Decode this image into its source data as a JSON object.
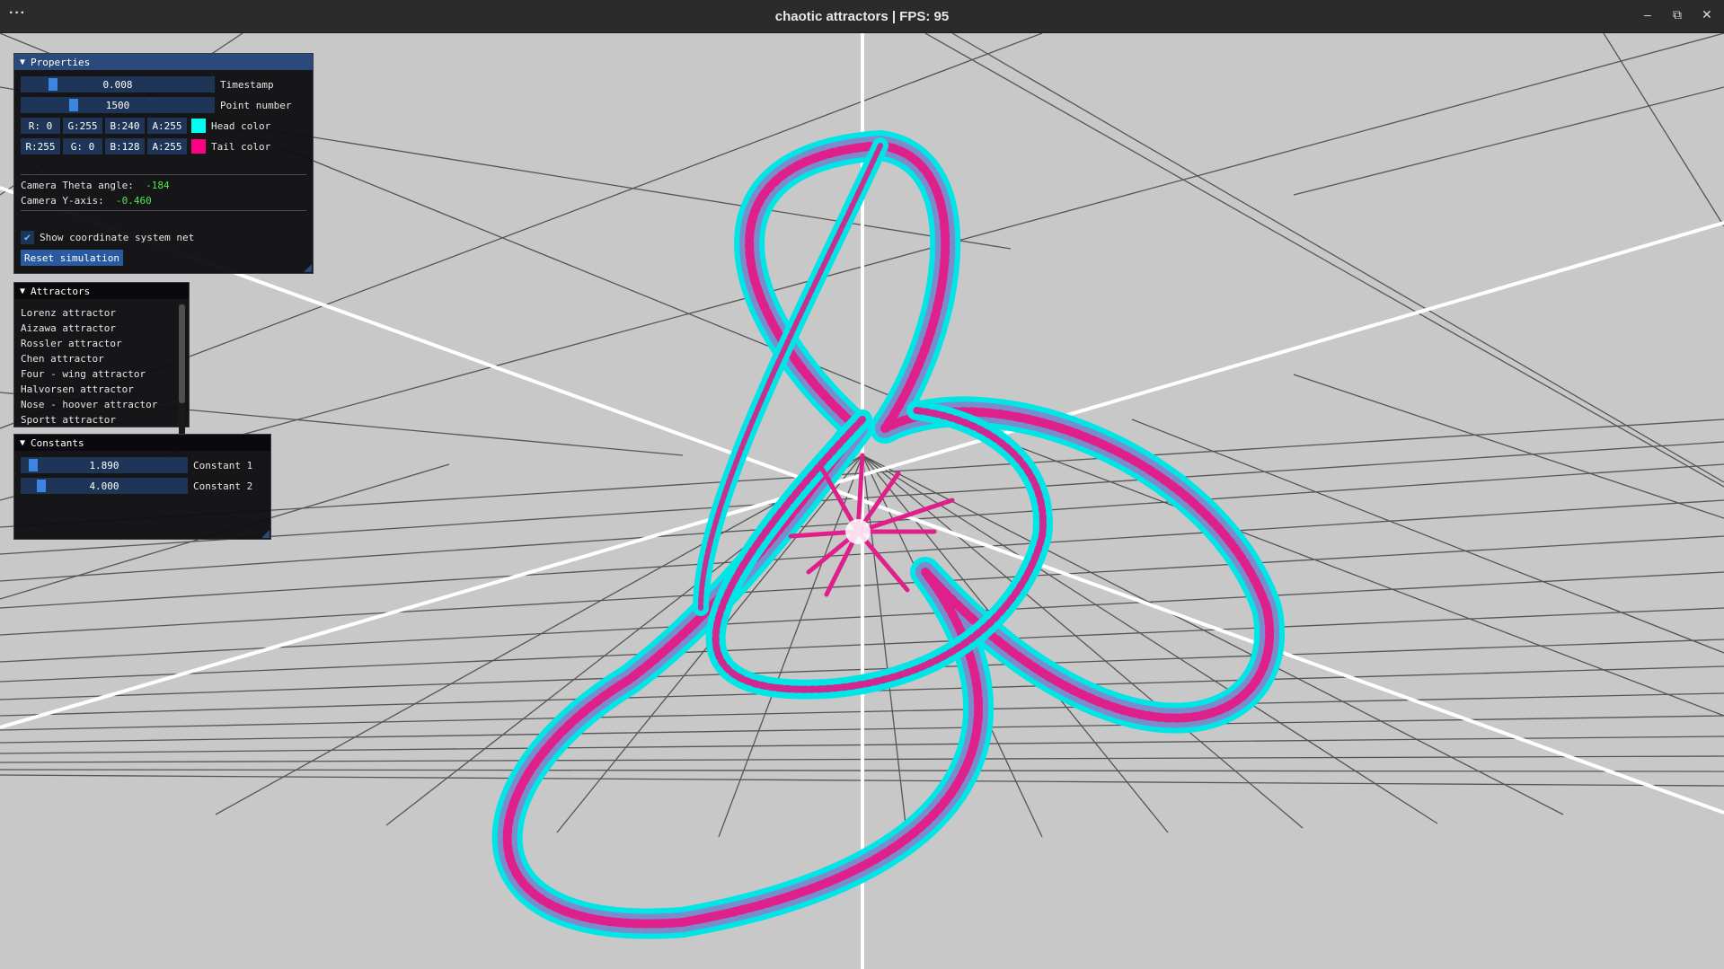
{
  "window": {
    "title": "chaotic attractors | FPS: 95",
    "menu_glyph": "···",
    "minimize_glyph": "–",
    "restore_glyph": "⧉",
    "close_glyph": "✕"
  },
  "colors": {
    "background": "#c8c8c8",
    "head": "#00ffef",
    "tail": "#ff0080",
    "accent": "#294a7a"
  },
  "properties": {
    "header": "Properties",
    "timestamp": {
      "value": "0.008",
      "label": "Timestamp",
      "fraction": 0.15
    },
    "point_number": {
      "value": "1500",
      "label": "Point number",
      "fraction": 0.26
    },
    "head_color": {
      "r": "R:  0",
      "g": "G:255",
      "b": "B:240",
      "a": "A:255",
      "label": "Head color",
      "swatch": "#00ffef"
    },
    "tail_color": {
      "r": "R:255",
      "g": "G:  0",
      "b": "B:128",
      "a": "A:255",
      "label": "Tail color",
      "swatch": "#ff0080"
    },
    "camera_theta_label": "Camera Theta angle:",
    "camera_theta_value": "-184",
    "camera_y_label": "Camera Y-axis:",
    "camera_y_value": "-0.460",
    "show_net_label": "Show coordinate system net",
    "show_net_checked": true,
    "reset_label": "Reset simulation"
  },
  "attractors": {
    "header": "Attractors",
    "items": [
      "Lorenz attractor",
      "Aizawa attractor",
      "Rossler attractor",
      "Chen attractor",
      "Four - wing attractor",
      "Halvorsen attractor",
      "Nose - hoover attractor",
      "Sportt attractor"
    ]
  },
  "constants": {
    "header": "Constants",
    "c1": {
      "value": "1.890",
      "label": "Constant 1",
      "fraction": 0.05
    },
    "c2": {
      "value": "4.000",
      "label": "Constant 2",
      "fraction": 0.1
    }
  }
}
